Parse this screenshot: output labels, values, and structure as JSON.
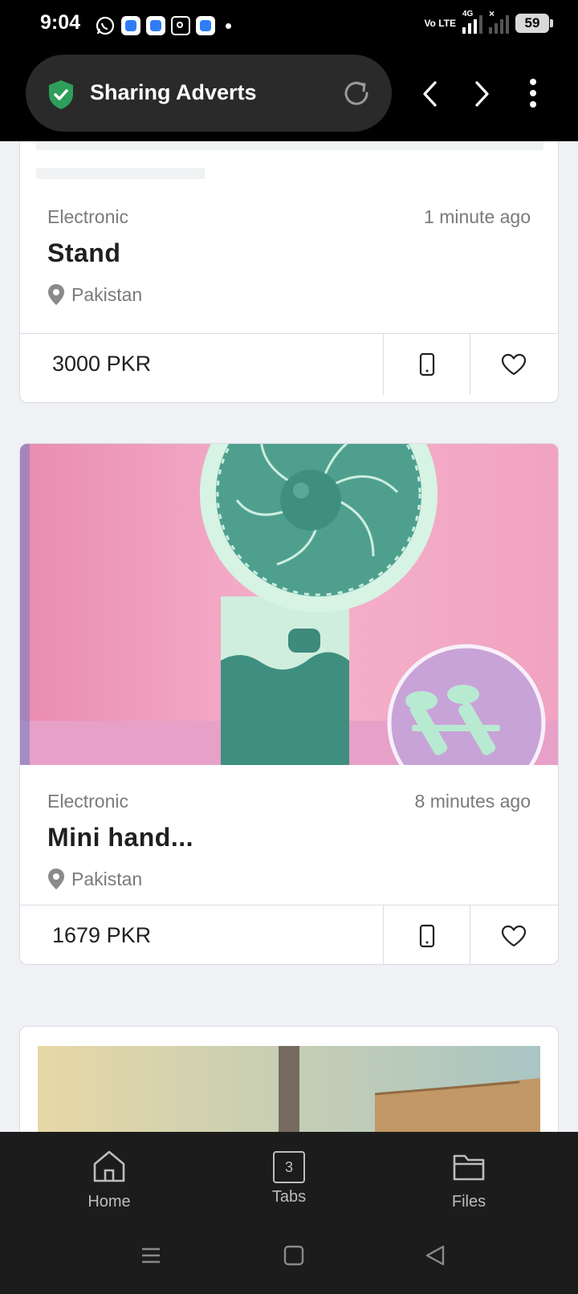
{
  "status_bar": {
    "time": "9:04",
    "network_label": "Vo LTE",
    "network_type": "4G",
    "battery": "59"
  },
  "toolbar": {
    "site_title": "Sharing Adverts"
  },
  "listings": [
    {
      "category": "Electronic",
      "time_ago": "1 minute ago",
      "title": "Stand",
      "location": "Pakistan",
      "price": "3000 PKR"
    },
    {
      "category": "Electronic",
      "time_ago": "8 minutes ago",
      "title": "Mini hand...",
      "location": "Pakistan",
      "price": "1679 PKR"
    }
  ],
  "bottom_nav": {
    "home_label": "Home",
    "tabs_label": "Tabs",
    "tabs_count": "3",
    "files_label": "Files"
  },
  "colors": {
    "accent_green": "#2e9e5b",
    "background": "#eff1f5",
    "toolbar_bg": "#000000"
  }
}
